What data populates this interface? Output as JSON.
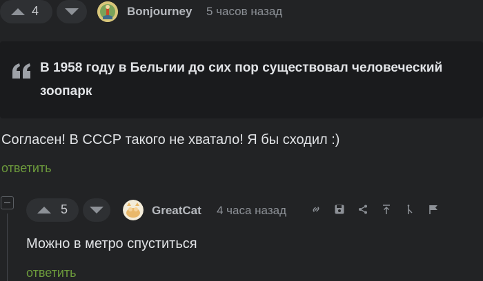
{
  "comment1": {
    "votes": "4",
    "author": "Bonjourney",
    "time": "5 часов назад",
    "quote": "В 1958 году в Бельгии до сих пор существовал человеческий зоопарк",
    "text": "Согласен! В СССР такого не хватало! Я бы сходил :)",
    "reply": "ответить"
  },
  "comment2": {
    "votes": "5",
    "author": "GreatCat",
    "time": "4 часа назад",
    "text": "Можно в метро спуститься",
    "reply": "ответить"
  },
  "icons": {
    "quote": "quote-icon",
    "link": "link-icon",
    "save": "save-icon",
    "share": "share-icon",
    "scroll_top": "arrow-up-to-line-icon",
    "branch": "branch-icon",
    "report": "flag-icon"
  }
}
